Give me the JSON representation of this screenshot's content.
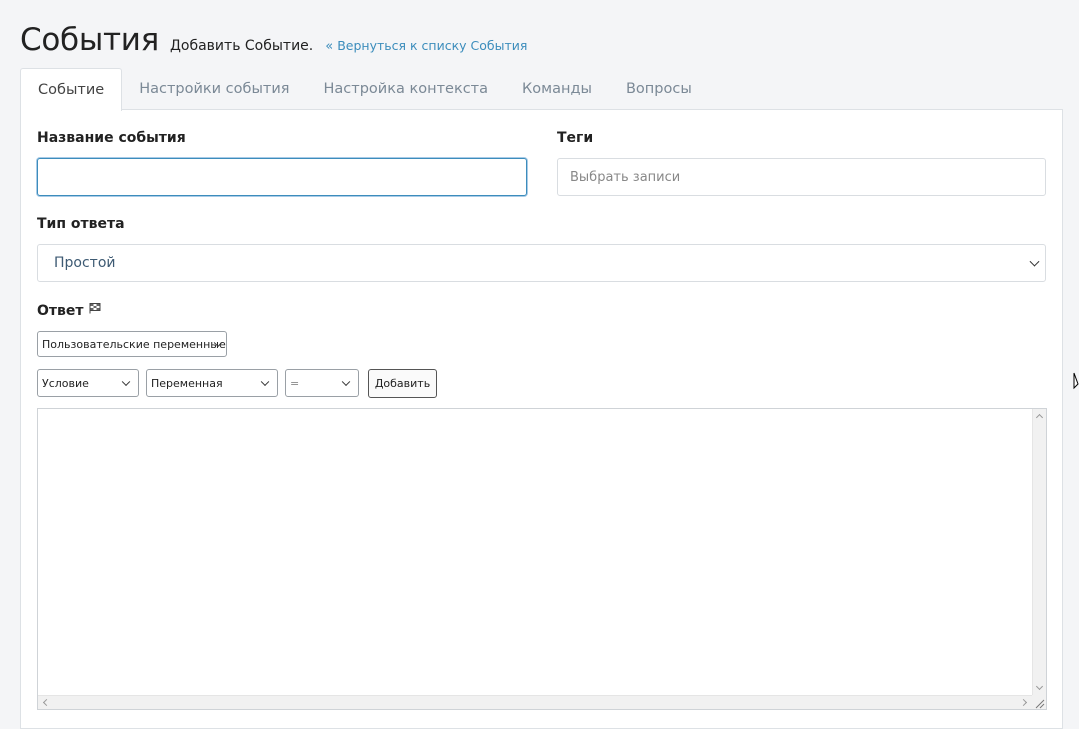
{
  "header": {
    "title": "События",
    "subtitle": "Добавить Событие.",
    "back_link": "Вернуться к списку События",
    "back_icon": "double-chevron-left-icon"
  },
  "tabs": [
    {
      "label": "Событие",
      "active": true
    },
    {
      "label": "Настройки события",
      "active": false
    },
    {
      "label": "Настройка контекста",
      "active": false
    },
    {
      "label": "Команды",
      "active": false
    },
    {
      "label": "Вопросы",
      "active": false
    }
  ],
  "form": {
    "event_name": {
      "label": "Название события",
      "value": ""
    },
    "tags": {
      "label": "Теги",
      "placeholder": "Выбрать записи"
    },
    "response_type": {
      "label": "Тип ответа",
      "selected": "Простой"
    },
    "answer": {
      "label": "Ответ",
      "label_icon": "flag-icon",
      "variables_select": "Пользовательские переменные",
      "condition_select": "Условие",
      "variable_select": "Переменная",
      "operator_select": "=",
      "add_button": "Добавить",
      "text": ""
    }
  },
  "colors": {
    "link": "#3c8dbc",
    "focus_border": "#3c8dbc",
    "tab_inactive": "#7b8996",
    "background": "#f4f5f7"
  }
}
